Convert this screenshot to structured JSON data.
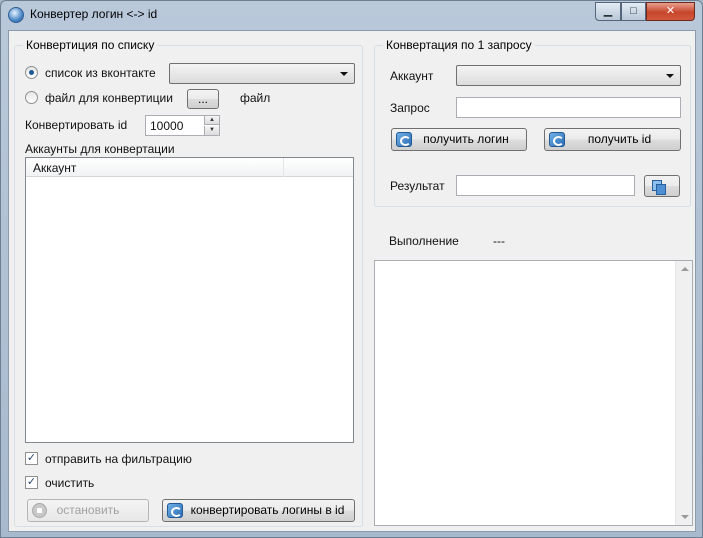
{
  "window": {
    "title": "Конвертер логин <-> id",
    "minimize": "▁",
    "maximize": "□",
    "close": "✕"
  },
  "list_group": {
    "title": "Конвертиция по списку",
    "radio_vk_label": "список из вконтакте",
    "radio_vk_selected": true,
    "vk_combo_value": "",
    "radio_file_label": "файл для конвертиции",
    "radio_file_selected": false,
    "browse_button": "...",
    "file_label": "файл",
    "convert_id_label": "Конвертировать id",
    "convert_id_value": "10000",
    "accounts_label": "Аккаунты для конвертации",
    "accounts_table": {
      "columns": [
        "Аккаунт",
        ""
      ],
      "rows": []
    },
    "send_filter_label": "отправить на фильтрацию",
    "send_filter_checked": true,
    "clear_label": "очистить",
    "clear_checked": true,
    "stop_button": "остановить",
    "convert_button": "конвертировать логины в id"
  },
  "single_group": {
    "title": "Конвертация по 1 запросу",
    "account_label": "Аккаунт",
    "account_value": "",
    "query_label": "Запрос",
    "query_value": "",
    "get_login_button": "получить логин",
    "get_id_button": "получить id",
    "result_label": "Результат",
    "result_value": ""
  },
  "progress": {
    "label": "Выполнение",
    "value": "---",
    "log_text": ""
  }
}
